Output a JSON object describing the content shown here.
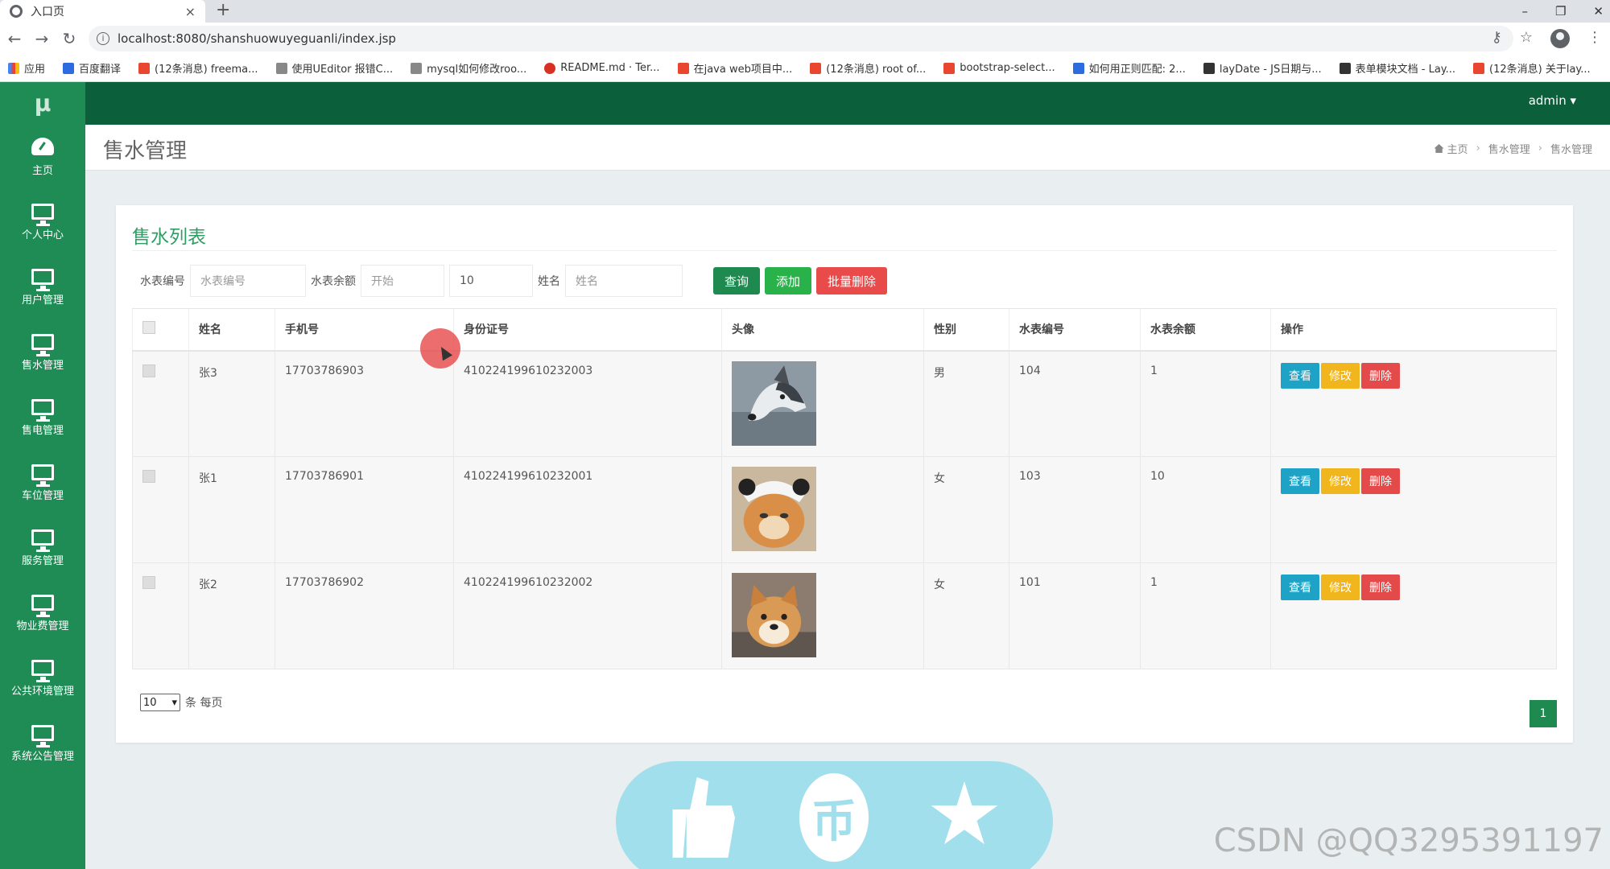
{
  "browser": {
    "tab_title": "入口页",
    "tab_close": "×",
    "new_tab": "+",
    "url": "localhost:8080/shanshuowuyeguanli/index.jsp",
    "win_min": "–",
    "win_restore": "❐",
    "win_close": "✕",
    "back": "←",
    "forward": "→",
    "reload": "↻",
    "key_icon": "⚷",
    "star_icon": "☆",
    "menu_icon": "⋮",
    "bookmarks": [
      {
        "label": "应用",
        "icon": "grid"
      },
      {
        "label": "百度翻译",
        "icon": "blue"
      },
      {
        "label": "(12条消息) freema...",
        "icon": "red"
      },
      {
        "label": "使用UEditor 报错C...",
        "icon": "gray"
      },
      {
        "label": "mysql如何修改roo...",
        "icon": "gray"
      },
      {
        "label": "README.md · Ter...",
        "icon": "round"
      },
      {
        "label": "在java web项目中...",
        "icon": "red"
      },
      {
        "label": "(12条消息) root of...",
        "icon": "red"
      },
      {
        "label": "bootstrap-select...",
        "icon": "red"
      },
      {
        "label": "如何用正则匹配: 2...",
        "icon": "blue"
      },
      {
        "label": "layDate - JS日期与...",
        "icon": "dark"
      },
      {
        "label": "表单模块文档 - Lay...",
        "icon": "dark"
      },
      {
        "label": "(12条消息) 关于lay...",
        "icon": "red"
      }
    ]
  },
  "app": {
    "brand": "μ",
    "user": "admin ▾",
    "sidebar": [
      {
        "label": "主页",
        "icon": "dashboard-icon"
      },
      {
        "label": "个人中心",
        "icon": "monitor-icon"
      },
      {
        "label": "用户管理",
        "icon": "monitor-icon"
      },
      {
        "label": "售水管理",
        "icon": "monitor-icon"
      },
      {
        "label": "售电管理",
        "icon": "monitor-icon"
      },
      {
        "label": "车位管理",
        "icon": "monitor-icon"
      },
      {
        "label": "服务管理",
        "icon": "monitor-icon"
      },
      {
        "label": "物业费管理",
        "icon": "monitor-icon"
      },
      {
        "label": "公共环境管理",
        "icon": "monitor-icon"
      },
      {
        "label": "系统公告管理",
        "icon": "monitor-icon"
      }
    ],
    "page_title": "售水管理",
    "breadcrumb": [
      "主页",
      "售水管理",
      "售水管理"
    ],
    "breadcrumb_sep": "›"
  },
  "list": {
    "title": "售水列表",
    "filters": {
      "meter_label": "水表编号",
      "meter_placeholder": "水表编号",
      "balance_label": "水表余额",
      "balance_start_placeholder": "开始",
      "balance_end_value": "10",
      "name_label": "姓名",
      "name_placeholder": "姓名"
    },
    "buttons": {
      "query": "查询",
      "add": "添加",
      "batch_delete": "批量删除"
    },
    "columns": [
      "姓名",
      "手机号",
      "身份证号",
      "头像",
      "性别",
      "水表编号",
      "水表余额",
      "操作"
    ],
    "rows": [
      {
        "name": "张3",
        "phone": "17703786903",
        "id_card": "410224199610232003",
        "avatar": "husky",
        "gender": "男",
        "meter": "104",
        "balance": "1"
      },
      {
        "name": "张1",
        "phone": "17703786901",
        "id_card": "410224199610232001",
        "avatar": "cat",
        "gender": "女",
        "meter": "103",
        "balance": "10"
      },
      {
        "name": "张2",
        "phone": "17703786902",
        "id_card": "410224199610232002",
        "avatar": "shiba",
        "gender": "女",
        "meter": "101",
        "balance": "1"
      }
    ],
    "row_actions": {
      "view": "查看",
      "edit": "修改",
      "delete": "删除"
    },
    "page_size": "10",
    "page_size_suffix": "条 每页",
    "current_page": "1"
  },
  "overlay": {
    "coin_glyph": "币"
  },
  "watermark": "CSDN @QQ3295391197"
}
